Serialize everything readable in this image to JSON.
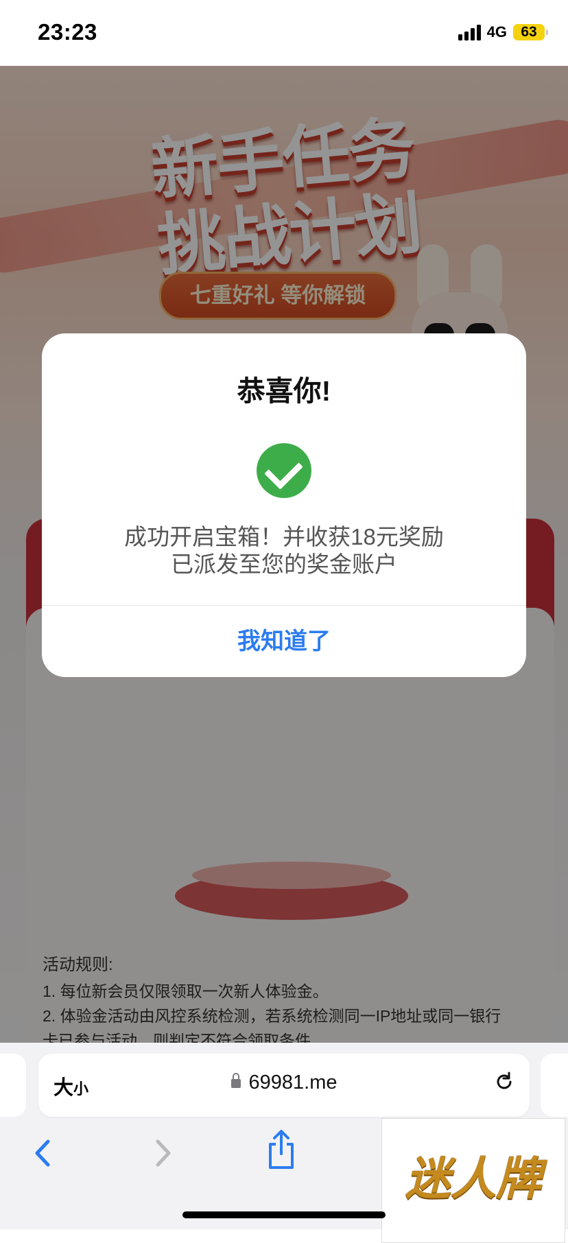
{
  "status_bar": {
    "time": "23:23",
    "network": "4G",
    "battery": "63"
  },
  "background": {
    "hero_title": "新手任务挑战计划",
    "hero_subtitle": "七重好礼 等你解锁",
    "rules_title": "活动规则:",
    "rules": [
      "1. 每位新会员仅限领取一次新人体验金。",
      "2. 体验金活动由风控系统检测，若系统检测同一IP地址或同一银行",
      "卡已参与活动，则判定不符合领取条件。"
    ]
  },
  "modal": {
    "title": "恭喜你!",
    "icon": "check-circle-icon",
    "message_line1": "成功开启宝箱！并收获18元奖励",
    "message_line2": "已派发至您的奖金账户",
    "button_label": "我知道了",
    "icon_color": "#3dad4a",
    "button_color": "#2b7cf0"
  },
  "browser": {
    "text_size_large": "大",
    "text_size_small": "小",
    "url": "69981.me"
  },
  "ad": {
    "text": "迷人牌"
  }
}
